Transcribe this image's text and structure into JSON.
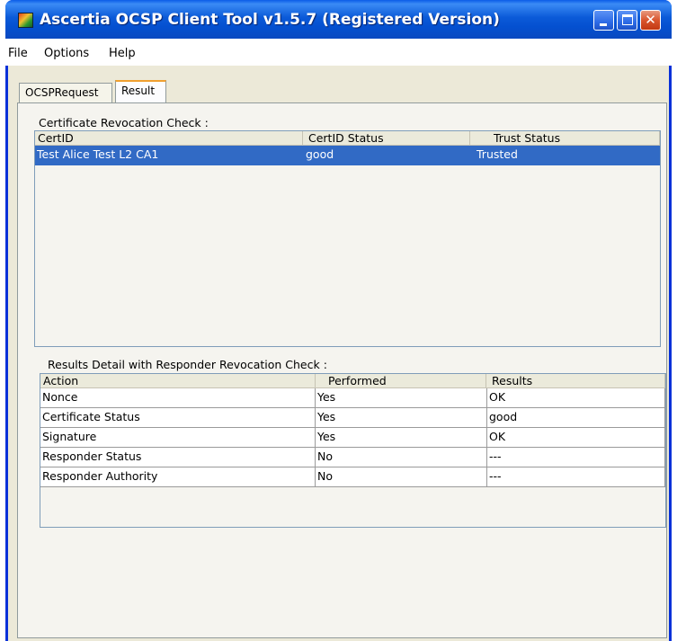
{
  "window": {
    "title": "Ascertia OCSP Client Tool v1.5.7 (Registered Version)",
    "icons": {
      "app": "app-logo-icon",
      "minimize": "minimize-icon",
      "maximize": "maximize-icon",
      "close": "close-icon"
    },
    "close_glyph": "✕"
  },
  "menu": [
    "File",
    "Options",
    "Help"
  ],
  "tabs": [
    {
      "label": "OCSPRequest",
      "active": false
    },
    {
      "label": "Result",
      "active": true
    }
  ],
  "revocation": {
    "label": "Certificate Revocation Check :",
    "columns": [
      "CertID",
      "CertID Status",
      "Trust Status"
    ],
    "rows": [
      [
        "Test Alice Test L2 CA1",
        "good",
        "Trusted"
      ]
    ]
  },
  "details": {
    "label": "Results Detail with Responder Revocation Check :",
    "columns": [
      "Action",
      "Performed",
      "Results"
    ],
    "rows": [
      [
        "Nonce",
        "Yes",
        "OK"
      ],
      [
        "Certificate Status",
        "Yes",
        "good"
      ],
      [
        "Signature",
        "Yes",
        "OK"
      ],
      [
        "Responder Status",
        "No",
        "---"
      ],
      [
        "Responder Authority",
        "No",
        "---"
      ]
    ]
  },
  "colors": {
    "title_bar": "#0a5ce8",
    "selection": "#316ac5",
    "active_tab_accent": "#f0a030"
  }
}
